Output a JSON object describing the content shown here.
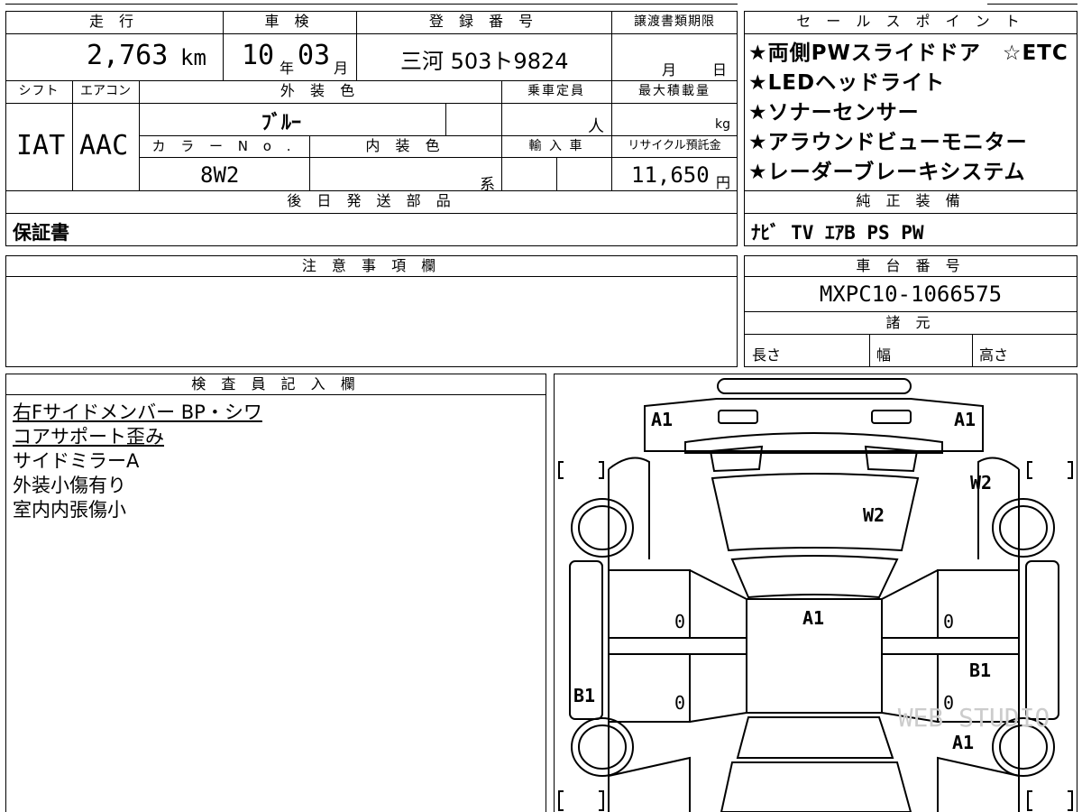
{
  "top_table": {
    "headers": {
      "mileage": "走 行",
      "inspection": "車 検",
      "registration": "登 録 番 号",
      "transfer_deadline": "譲渡書類期限",
      "shift": "シフト",
      "aircon": "エアコン",
      "exterior_color": "外 装 色",
      "capacity": "乗車定員",
      "max_load": "最大積載量",
      "color_no": "カ ラ ー N o .",
      "interior_color": "内 装 色",
      "import": "輸 入 車",
      "recycle_fee": "リサイクル預託金"
    },
    "values": {
      "mileage": "2,763",
      "mileage_unit": "km",
      "inspection_year": "10",
      "year_unit": "年",
      "inspection_month": "03",
      "month_unit": "月",
      "registration": "三河 503ト9824",
      "deadline_month_unit": "月",
      "deadline_day_unit": "日",
      "shift": "IAT",
      "aircon": "AAC",
      "exterior_color": "ﾌﾞﾙｰ",
      "capacity_unit": "人",
      "max_load_unit": "kg",
      "color_no": "8W2",
      "interior_unit": "系",
      "recycle_fee": "11,650",
      "yen_unit": "円"
    }
  },
  "later_parts": {
    "header": "後 日 発 送 部 品",
    "value": "保証書"
  },
  "notes": {
    "header": "注 意 事 項 欄"
  },
  "sales_points": {
    "header": "セ ー ル ス ポ イ ン ト",
    "items": [
      "★両側PWスライドドア　☆ETC",
      "★LEDヘッドライト",
      "★ソナーセンサー",
      "★アラウンドビューモニター",
      "★レーダーブレーキシステム"
    ]
  },
  "equipment": {
    "header": "純 正 装 備",
    "value": "ﾅﾋﾞ TV ｴｱB PS PW"
  },
  "chassis": {
    "header": "車 台 番 号",
    "value": "MXPC10-1066575"
  },
  "specs": {
    "header": "諸 元",
    "length": "長さ",
    "width": "幅",
    "height": "高さ"
  },
  "inspector": {
    "header": "検 査 員 記 入 欄",
    "lines": [
      "右Fサイドメンバー BP・シワ",
      "コアサポート歪み",
      "サイドミラーA",
      "外装小傷有り",
      "室内内張傷小"
    ]
  },
  "diagram": {
    "marks": {
      "front_bumper_left": "A1",
      "front_bumper_right": "A1",
      "hood": "W2",
      "right_front_fender": "W2",
      "roof": "A1",
      "left_front_door": "0",
      "left_rear_door": "0",
      "right_front_door": "0",
      "right_rear_door": "0",
      "left_rocker": "B1",
      "right_rear_door_area": "B1",
      "right_rear_fender": "A1"
    },
    "watermark": "WEB STUDIO"
  }
}
